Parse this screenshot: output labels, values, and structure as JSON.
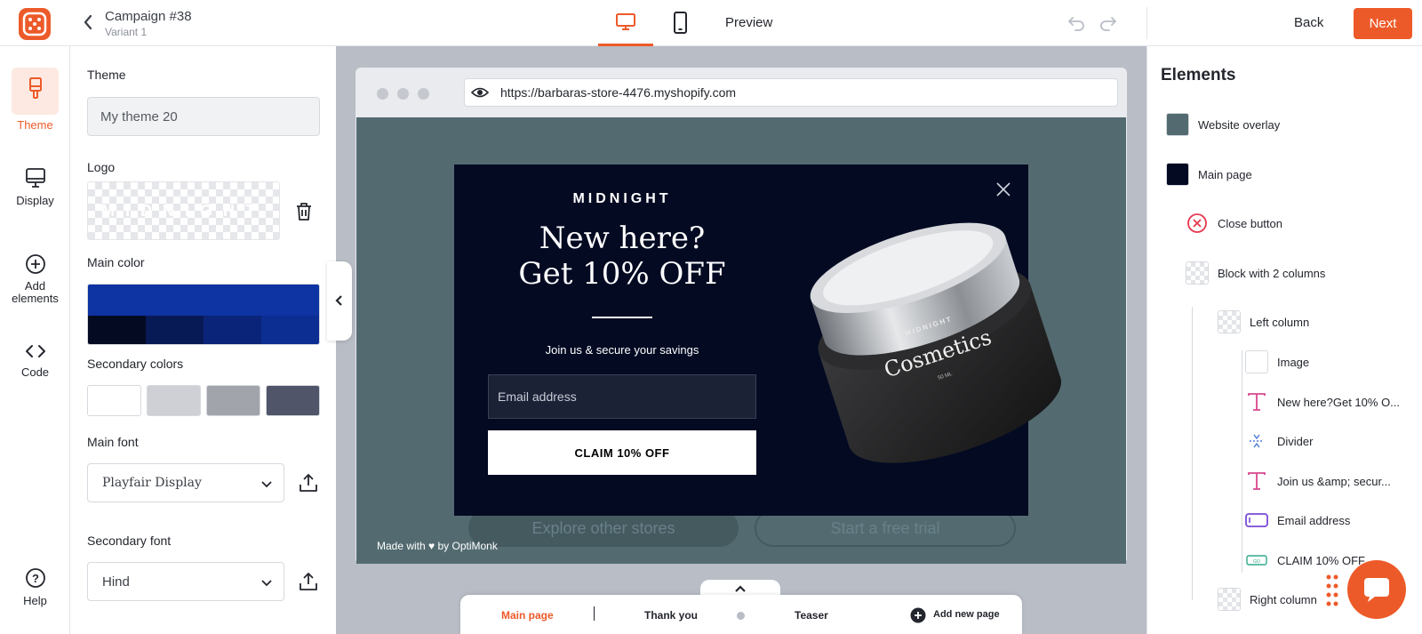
{
  "header": {
    "campaign_title": "Campaign #38",
    "variant": "Variant 1",
    "preview_label": "Preview",
    "back_label": "Back",
    "next_label": "Next"
  },
  "rail": {
    "theme": "Theme",
    "display": "Display",
    "add_elements": "Add elements",
    "code": "Code",
    "help": "Help"
  },
  "theme_panel": {
    "theme_label": "Theme",
    "theme_value": "My theme 20",
    "logo_label": "Logo",
    "logo_text": "MIDNIGHT",
    "main_color_label": "Main color",
    "main_color": "#0e33a2",
    "main_color_shades": [
      "#030a22",
      "#081a55",
      "#0a247a",
      "#0c2d91"
    ],
    "secondary_colors_label": "Secondary colors",
    "secondary_colors": [
      "#ffffff",
      "#ced0d5",
      "#a2a4ab",
      "#50556a"
    ],
    "main_font_label": "Main font",
    "main_font_value": "Playfair Display",
    "secondary_font_label": "Secondary font",
    "secondary_font_value": "Hind"
  },
  "browser": {
    "url": "https://barbaras-store-4476.myshopify.com",
    "bg_button_1": "Explore other stores",
    "bg_button_2": "Start a free trial",
    "made_with": "Made with ♥ by OptiMonk"
  },
  "popup": {
    "brand": "MIDNIGHT",
    "headline_line1": "New here?",
    "headline_line2": "Get 10% OFF",
    "subtext": "Join us & secure your savings",
    "email_placeholder": "Email address",
    "cta": "CLAIM 10% OFF",
    "jar_brand": "MIDNIGHT",
    "jar_label": "Cosmetics",
    "jar_size": "50 ML"
  },
  "page_tabs": {
    "main": "Main page",
    "thank_you": "Thank you",
    "teaser": "Teaser",
    "add_new": "Add new page"
  },
  "elements_panel": {
    "title": "Elements",
    "items": [
      {
        "label": "Website overlay",
        "icon": "swatch"
      },
      {
        "label": "Main page",
        "icon": "swatch"
      },
      {
        "label": "Close button",
        "icon": "close-circle-icon"
      },
      {
        "label": "Block with 2 columns",
        "icon": "checker"
      },
      {
        "label": "Left column",
        "icon": "checker"
      },
      {
        "label": "Image",
        "icon": "image-icon"
      },
      {
        "label": "New here?Get 10% O...",
        "icon": "text-icon"
      },
      {
        "label": "Divider",
        "icon": "divider-icon"
      },
      {
        "label": "Join us &amp; secur...",
        "icon": "text-icon"
      },
      {
        "label": "Email address",
        "icon": "input-icon"
      },
      {
        "label": "CLAIM 10% OFF",
        "icon": "button-icon"
      },
      {
        "label": "Right column",
        "icon": "checker"
      }
    ]
  },
  "colors": {
    "accent": "#ed5a29",
    "overlay": "#536b70",
    "popup_bg": "#030a22"
  }
}
